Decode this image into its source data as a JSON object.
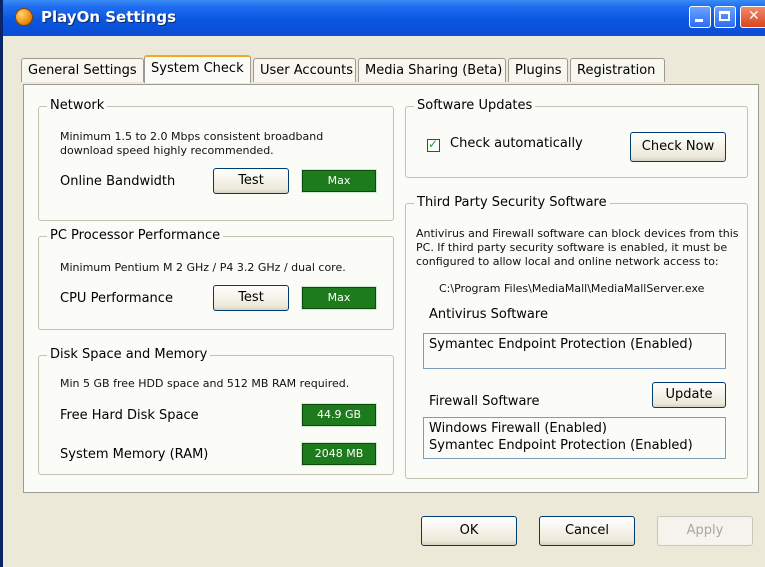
{
  "window": {
    "title": "PlayOn Settings"
  },
  "tabs": [
    {
      "label": "General Settings"
    },
    {
      "label": "System Check"
    },
    {
      "label": "User Accounts"
    },
    {
      "label": "Media Sharing (Beta)"
    },
    {
      "label": "Plugins"
    },
    {
      "label": "Registration"
    }
  ],
  "network": {
    "title": "Network",
    "description_line1": "Minimum 1.5 to 2.0 Mbps consistent broadband",
    "description_line2": "download speed highly recommended.",
    "row_label": "Online Bandwidth",
    "test_label": "Test",
    "result": "Max"
  },
  "processor": {
    "title": "PC Processor Performance",
    "description": "Minimum Pentium M 2 GHz / P4 3.2 GHz / dual core.",
    "row_label": "CPU Performance",
    "test_label": "Test",
    "result": "Max"
  },
  "disk": {
    "title": "Disk Space and Memory",
    "description": "Min 5 GB free HDD space and 512 MB RAM required.",
    "free_disk_label": "Free Hard Disk Space",
    "free_disk_value": "44.9 GB",
    "memory_label": "System Memory (RAM)",
    "memory_value": "2048 MB"
  },
  "updates": {
    "title": "Software Updates",
    "check_auto_label": "Check automatically",
    "check_auto_checked": true,
    "check_now_label": "Check Now"
  },
  "security": {
    "title": "Third Party Security Software",
    "description_line1": "Antivirus and Firewall software can block devices from this",
    "description_line2": "PC. If third party security software is enabled, it must be",
    "description_line3": "configured to allow local and online network access to:",
    "server_path": "C:\\Program Files\\MediaMall\\MediaMallServer.exe",
    "antivirus_label": "Antivirus Software",
    "antivirus_items": [
      "Symantec Endpoint Protection (Enabled)"
    ],
    "firewall_label": "Firewall Software",
    "update_label": "Update",
    "firewall_items": [
      "Windows Firewall (Enabled)",
      "Symantec Endpoint Protection (Enabled)"
    ]
  },
  "footer": {
    "ok_label": "OK",
    "cancel_label": "Cancel",
    "apply_label": "Apply"
  }
}
